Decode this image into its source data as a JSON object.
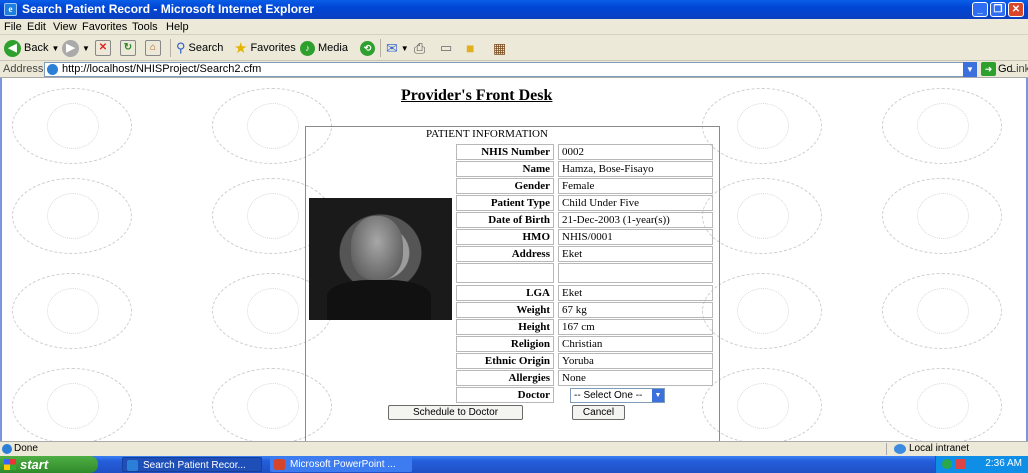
{
  "window": {
    "title": "Search Patient Record - Microsoft Internet Explorer",
    "buttons": [
      "minimize",
      "maximize",
      "close"
    ]
  },
  "menu": [
    "File",
    "Edit",
    "View",
    "Favorites",
    "Tools",
    "Help"
  ],
  "toolbar": {
    "back": "Back",
    "search": "Search",
    "favorites": "Favorites",
    "media": "Media"
  },
  "address": {
    "label": "Address",
    "url": "http://localhost/NHISProject/Search2.cfm",
    "go": "Go",
    "links": "Links"
  },
  "page": {
    "heading": "Provider's Front Desk",
    "panel_title": "PATIENT INFORMATION",
    "fields": [
      {
        "label": "NHIS Number",
        "value": "0002"
      },
      {
        "label": "Name",
        "value": "Hamza, Bose-Fisayo"
      },
      {
        "label": "Gender",
        "value": "Female"
      },
      {
        "label": "Patient Type",
        "value": "Child Under Five"
      },
      {
        "label": "Date of Birth",
        "value": "21-Dec-2003 (1-year(s))"
      },
      {
        "label": "HMO",
        "value": "NHIS/0001"
      },
      {
        "label": "Address",
        "value": "Eket"
      },
      {
        "label": "",
        "value": ""
      },
      {
        "label": "LGA",
        "value": "Eket"
      },
      {
        "label": "Weight",
        "value": "67 kg"
      },
      {
        "label": "Height",
        "value": "167 cm"
      },
      {
        "label": "Religion",
        "value": "Christian"
      },
      {
        "label": "Ethnic Origin",
        "value": "Yoruba"
      },
      {
        "label": "Allergies",
        "value": "None"
      }
    ],
    "doctor_label": "Doctor",
    "doctor_select": "-- Select One --",
    "schedule_button": "Schedule to Doctor",
    "cancel_button": "Cancel"
  },
  "status": {
    "text": "Done",
    "zone": "Local intranet"
  },
  "taskbar": {
    "start": "start",
    "tasks": [
      "Search Patient Recor...",
      "Microsoft PowerPoint ..."
    ],
    "clock": "2:36 AM"
  }
}
